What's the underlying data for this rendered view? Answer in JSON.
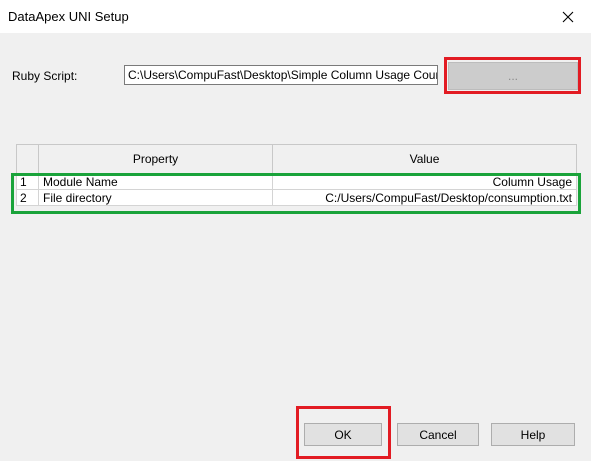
{
  "window": {
    "title": "DataApex UNI Setup"
  },
  "ruby_script": {
    "label": "Ruby Script:",
    "value": "C:\\Users\\CompuFast\\Desktop\\Simple Column Usage Cour",
    "browse_label": "..."
  },
  "grid": {
    "columns": [
      "Property",
      "Value"
    ],
    "rows": [
      {
        "index": "1",
        "property": "Module Name",
        "value": "Column Usage"
      },
      {
        "index": "2",
        "property": "File directory",
        "value": "C:/Users/CompuFast/Desktop/consumption.txt"
      }
    ]
  },
  "buttons": {
    "ok_label": "OK",
    "cancel_label": "Cancel",
    "help_label": "Help"
  },
  "colors": {
    "highlight_red": "#e21b23",
    "highlight_green": "#1aa33a"
  }
}
